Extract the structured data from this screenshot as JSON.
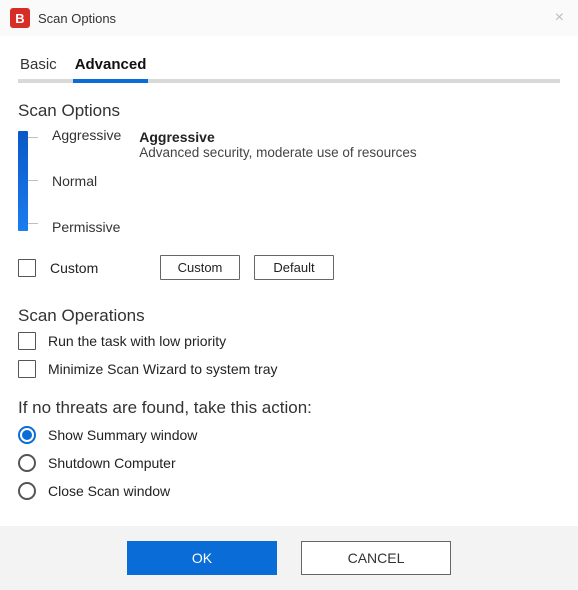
{
  "window": {
    "app_badge": "B",
    "title": "Scan Options",
    "close_glyph": "×"
  },
  "tabs": {
    "basic": "Basic",
    "advanced": "Advanced",
    "active": "advanced"
  },
  "sections": {
    "scan_options": "Scan Options",
    "scan_operations": "Scan Operations",
    "no_threats": "If no threats are found, take this action:"
  },
  "levels": {
    "items": [
      "Aggressive",
      "Normal",
      "Permissive"
    ],
    "selected": "Aggressive",
    "description_title": "Aggressive",
    "description_text": "Advanced security, moderate use of resources"
  },
  "custom": {
    "label": "Custom",
    "checked": false,
    "custom_btn": "Custom",
    "default_btn": "Default"
  },
  "operations": [
    {
      "label": "Run the task with low priority",
      "checked": false
    },
    {
      "label": "Minimize Scan Wizard to system tray",
      "checked": false
    }
  ],
  "no_threats_options": [
    {
      "label": "Show Summary window",
      "selected": true
    },
    {
      "label": "Shutdown Computer",
      "selected": false
    },
    {
      "label": "Close Scan window",
      "selected": false
    }
  ],
  "footer": {
    "ok": "OK",
    "cancel": "CANCEL"
  }
}
